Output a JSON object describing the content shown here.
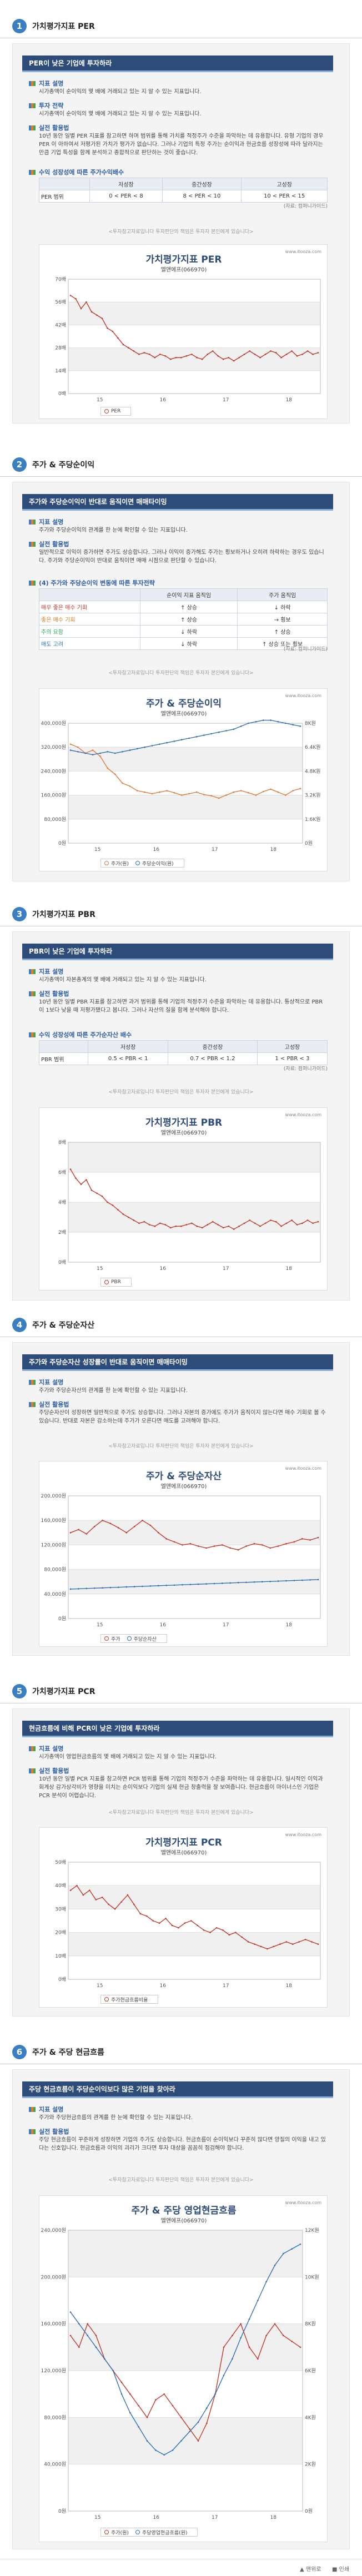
{
  "s1": {
    "num": "1",
    "title": "가치평가지표 PER",
    "banner": "PER이 낮은 기업에 투자하라",
    "h1": "지표 설명",
    "t1": "시가총액이 순이익의 몇 배에 거래되고 있는 지 알 수 있는 지표입니다.",
    "h2": "투자 전략",
    "t2": "시가총액이 순이익의 몇 배에 거래되고 있는 지 알 수 있는 지표입니다.",
    "h3": "실전 활용법",
    "t3": "10년 동안 일별 PER 지표를 참고하면 하며 범위를 통해 가치를 적정주가 수준을 파악하는 데 유용합니다. 유형 기업의 경우 PER 이 아하여서 저평가된 가치가 평가가 없습니다. 그러나 기업의 특정 주가는 순이익과 현금흐름 성장성에 따라 달라지는 만큼 기업 특성을 함께 분석하고 종합적으로 판단하는 것이 좋습니다.",
    "h4": "수익 성장성에 따른 주가수익배수",
    "th": [
      "",
      "저성장",
      "중간성장",
      "고성장"
    ],
    "row": [
      "PER 범위",
      "0 < PER < 8",
      "8 < PER < 10",
      "10 < PER < 15"
    ],
    "src": "(자료: 컴퍼니가이드)",
    "foot": "<투자참고자료입니다 투자판단의 책임은 투자자 본인에게 있습니다>"
  },
  "c1": {
    "title": "가치평가지표 PER",
    "sub": "엘앤에프(066970)",
    "url": "www.itooza.com",
    "legend": "PER"
  },
  "s2": {
    "num": "2",
    "title": "주가 & 주당순이익",
    "banner": "주가와 주당순이익이 반대로 움직이면 매매타이밍",
    "h1": "지표 설명",
    "t1": "주가와 주당순이익의 관계를 한 눈에 확인할 수 있는 지표입니다.",
    "h2": "실전 활용법",
    "t2": "일반적으로 이익이 증가하면 주가도 상승합니다. 그러나 이익이 증가해도 주가는 횡보하거나 오히려 하락하는 경우도 있습니다. 주가와 주당순이익이 반대로 움직이면 매매 시점으로 판단할 수 있습니다.",
    "h3": "(4) 주가와 주당순이익 변동에 따른 투자전략",
    "th": [
      "",
      "순이익 지표 움직임",
      "주가 움직임"
    ],
    "rows": [
      [
        "매우 좋은 매수 기회",
        "↑ 상승",
        "↓ 하락"
      ],
      [
        "좋은 매수 기회",
        "↑ 상승",
        "→ 횡보"
      ],
      [
        "주의 요함",
        "↓ 하락",
        "↑ 상승"
      ],
      [
        "매도 고려",
        "↓ 하락",
        "↑ 상승 또는 횡보"
      ]
    ],
    "row_colors": [
      "#c0392b",
      "#e67e22",
      "#27ae60",
      "#2e6fb5"
    ],
    "src": "(자료: 컴퍼니가이드)",
    "foot": "<투자참고자료입니다 투자판단의 책임은 투자자 본인에게 있습니다>"
  },
  "c2": {
    "title": "주가 & 주당순이익",
    "sub": "엘앤에프(066970)",
    "url": "www.itooza.com",
    "legend1": "주가(원)",
    "legend2": "주당순이익(원)"
  },
  "s3": {
    "num": "3",
    "title": "가치평가지표 PBR",
    "banner": "PBR이 낮은 기업에 투자하라",
    "h1": "지표 설명",
    "t1": "시가총액이 자본총계의 몇 배에 거래되고 있는 지 알 수 있는 지표입니다.",
    "h2": "실전 활용법",
    "t2": "10년 동안 일별 PBR 지표를 참고하면 과거 범위를 통해 기업의 적정주가 수준을 파악하는 데 유용합니다. 통상적으로 PBR이 1보다 낮을 때 저평가됐다고 봅니다. 그러나 자산의 질을 함께 분석해야 합니다.",
    "h3": "수익 성장성에 따른 주가순자산 배수",
    "th": [
      "",
      "저성장",
      "중간성장",
      "고성장"
    ],
    "row": [
      "PBR 범위",
      "0.5 < PBR < 1",
      "0.7 < PBR < 1.2",
      "1 < PBR < 3"
    ],
    "src": "(자료: 컴퍼니가이드)",
    "foot": "<투자참고자료입니다 투자판단의 책임은 투자자 본인에게 있습니다>"
  },
  "c3": {
    "title": "가치평가지표 PBR",
    "sub": "엘앤에프(066970)",
    "url": "www.itooza.com",
    "legend": "PBR"
  },
  "s4": {
    "num": "4",
    "title": "주가 & 주당순자산",
    "banner": "주가와 주당순자산 성장률이 반대로 움직이면 매매타이밍",
    "h1": "지표 설명",
    "t1": "주가와 주당순자산의 관계를 한 눈에 확인할 수 있는 지표입니다.",
    "h2": "실전 활용법",
    "t2": "주당순자산이 성장하면 일반적으로 주가도 상승합니다. 그러나 자본의 증가에도 주가가 움직이지 않는다면 매수 기회로 볼 수 있습니다. 반대로 자본은 감소하는데 주가가 오른다면 매도를 고려해야 합니다.",
    "foot": "<투자참고자료입니다 투자판단의 책임은 투자자 본인에게 있습니다>"
  },
  "c4": {
    "title": "주가 & 주당순자산",
    "sub": "엘앤에프(066970)",
    "url": "www.itooza.com",
    "legend1": "주가",
    "legend2": "주당순자산"
  },
  "s5": {
    "num": "5",
    "title": "가치평가지표 PCR",
    "banner": "현금흐름에 비해 PCR이 낮은 기업에 투자하라",
    "h1": "지표 설명",
    "t1": "시가총액이 영업현금흐름의 몇 배에 거래되고 있는 지 알 수 있는 지표입니다.",
    "h2": "실전 활용법",
    "t2": "10년 동안 일별 PCR 지표를 참고하면 PCR 범위를 통해 기업의 적정주가 수준을 파악하는 데 유용합니다. 일시적인 이익과 회계상 감가상각비가 영향을 미치는 순이익보다 기업의 실제 현금 창출력을 잘 보여줍니다. 현금흐름이 마이너스인 기업은 PCR 분석이 어렵습니다.",
    "foot": "<투자참고자료입니다 투자판단의 책임은 투자자 본인에게 있습니다>"
  },
  "c5": {
    "title": "가치평가지표 PCR",
    "sub": "엘앤에프(066970)",
    "url": "www.itooza.com",
    "legend": "주가현금흐름비율"
  },
  "s6": {
    "num": "6",
    "title": "주가 & 주당 현금흐름",
    "banner": "주당 현금흐름이 주당순이익보다 많은 기업을 찾아라",
    "h1": "지표 설명",
    "t1": "주가와 주당현금흐름의 관계를 한 눈에 확인할 수 있는 지표입니다.",
    "h2": "실전 활용법",
    "t2": "주당 현금흐름이 꾸준하게 성장하면 기업의 주가도 상승합니다. 현금흐름이 순이익보다 꾸준히 많다면 양질의 이익을 내고 있다는 신호입니다. 현금흐름과 이익의 괴리가 크다면 투자 대상을 꼼꼼히 점검해야 합니다.",
    "foot": "<투자참고자료입니다 투자판단의 책임은 투자자 본인에게 있습니다>"
  },
  "c6": {
    "title": "주가 & 주당 영업현금흐름",
    "sub": "엘앤에프(066970)",
    "url": "www.itooza.com",
    "legend1": "주가(원)",
    "legend2": "주당영업현금흐름(원)"
  },
  "bottom": {
    "left": "▲ 맨위로",
    "right": "■ 인쇄"
  },
  "chart_data": [
    {
      "type": "line",
      "title": "가치평가지표 PER",
      "subtitle": "엘앤에프(066970)",
      "x": [
        "15",
        "16",
        "17",
        "18"
      ],
      "yticks": [
        "0배",
        "14배",
        "28배",
        "42배",
        "56배",
        "70배"
      ],
      "ylim": [
        0,
        70
      ],
      "series": [
        {
          "name": "PER",
          "color": "#c0392b",
          "values": [
            60,
            58,
            52,
            56,
            50,
            48,
            46,
            40,
            38,
            34,
            30,
            28,
            26,
            24,
            25,
            24,
            22,
            24,
            23,
            21,
            22,
            22,
            23,
            24,
            22,
            21,
            24,
            26,
            23,
            21,
            22,
            20,
            22,
            24,
            26,
            24,
            22,
            24,
            26,
            25,
            22,
            24,
            26,
            23,
            24,
            26,
            24,
            25
          ]
        }
      ]
    },
    {
      "type": "line",
      "title": "주가 & 주당순이익",
      "subtitle": "엘앤에프(066970)",
      "x": [
        "15",
        "16",
        "17",
        "18"
      ],
      "yticks": [
        "0원",
        "80,000원",
        "160,000원",
        "240,000원",
        "320,000원",
        "400,000원"
      ],
      "ylim": [
        0,
        400000
      ],
      "y2ticks": [
        "0원",
        "1.6K원",
        "3.2K원",
        "4.8K원",
        "6.4K원",
        "8K원"
      ],
      "y2lim": [
        0,
        8000
      ],
      "series": [
        {
          "name": "주가(원)",
          "color": "#e07b39",
          "values": [
            330000,
            320000,
            300000,
            310000,
            290000,
            250000,
            230000,
            200000,
            190000,
            175000,
            170000,
            165000,
            170000,
            175000,
            168000,
            160000,
            165000,
            170000,
            162000,
            158000,
            150000,
            160000,
            170000,
            175000,
            168000,
            160000,
            172000,
            180000,
            170000,
            160000,
            175000,
            182000
          ]
        },
        {
          "name": "주당순이익(원)",
          "color": "#2e6fb5",
          "values": [
            6200,
            6100,
            6000,
            5900,
            6000,
            6100,
            6000,
            6100,
            6200,
            6300,
            6400,
            6500,
            6600,
            6700,
            6800,
            6900,
            7000,
            7100,
            7200,
            7300,
            7400,
            7500,
            7600,
            7800,
            8000,
            8100,
            8200,
            8200,
            8100,
            8000,
            7900,
            7800
          ]
        }
      ]
    },
    {
      "type": "line",
      "title": "가치평가지표 PBR",
      "subtitle": "엘앤에프(066970)",
      "x": [
        "15",
        "16",
        "17",
        "18"
      ],
      "yticks": [
        "0배",
        "2배",
        "4배",
        "6배",
        "8배"
      ],
      "ylim": [
        0,
        8
      ],
      "series": [
        {
          "name": "PBR",
          "color": "#c0392b",
          "values": [
            6.2,
            5.6,
            5.2,
            5.5,
            4.8,
            4.6,
            4.4,
            4.0,
            3.8,
            3.5,
            3.2,
            3.0,
            2.8,
            2.6,
            2.7,
            2.5,
            2.4,
            2.6,
            2.5,
            2.3,
            2.4,
            2.4,
            2.5,
            2.6,
            2.4,
            2.3,
            2.5,
            2.7,
            2.5,
            2.3,
            2.4,
            2.2,
            2.4,
            2.6,
            2.8,
            2.6,
            2.4,
            2.6,
            2.8,
            2.7,
            2.4,
            2.6,
            2.8,
            2.5,
            2.6,
            2.8,
            2.6,
            2.7
          ]
        }
      ]
    },
    {
      "type": "line",
      "title": "주가 & 주당순자산",
      "subtitle": "엘앤에프(066970)",
      "x": [
        "15",
        "16",
        "17",
        "18"
      ],
      "yticks": [
        "0원",
        "40,000원",
        "80,000원",
        "120,000원",
        "160,000원",
        "200,000원"
      ],
      "ylim": [
        0,
        200000
      ],
      "series": [
        {
          "name": "주가",
          "color": "#c0392b",
          "values": [
            140000,
            145000,
            138000,
            150000,
            160000,
            155000,
            148000,
            140000,
            150000,
            160000,
            152000,
            140000,
            130000,
            125000,
            120000,
            122000,
            118000,
            115000,
            118000,
            120000,
            115000,
            112000,
            118000,
            122000,
            120000,
            115000,
            118000,
            122000,
            125000,
            130000,
            128000,
            132000
          ]
        },
        {
          "name": "주당순자산",
          "color": "#2e6fb5",
          "values": [
            48000,
            48500,
            49000,
            49500,
            50000,
            50500,
            51000,
            51500,
            52000,
            52500,
            53000,
            53500,
            54000,
            54500,
            55000,
            55500,
            56000,
            56500,
            57000,
            57500,
            58000,
            58500,
            59000,
            59500,
            60000,
            60500,
            61000,
            61500,
            62000,
            62500,
            63000,
            63500
          ]
        }
      ]
    },
    {
      "type": "line",
      "title": "가치평가지표 PCR",
      "subtitle": "엘앤에프(066970)",
      "x": [
        "15",
        "16",
        "17",
        "18"
      ],
      "yticks": [
        "0배",
        "10배",
        "20배",
        "30배",
        "40배",
        "50배"
      ],
      "ylim": [
        0,
        50
      ],
      "series": [
        {
          "name": "주가현금흐름비율",
          "color": "#c0392b",
          "values": [
            38,
            40,
            36,
            38,
            34,
            35,
            32,
            30,
            33,
            36,
            32,
            28,
            27,
            25,
            24,
            26,
            23,
            22,
            24,
            25,
            23,
            21,
            20,
            22,
            21,
            19,
            20,
            18,
            16,
            15,
            14,
            13,
            14,
            15,
            16,
            15,
            16,
            17,
            16,
            15
          ]
        }
      ]
    },
    {
      "type": "line",
      "title": "주가 & 주당 영업현금흐름",
      "subtitle": "엘앤에프(066970)",
      "x": [
        "15",
        "16",
        "17",
        "18"
      ],
      "yticks": [
        "0원",
        "40,000원",
        "80,000원",
        "120,000원",
        "160,000원",
        "200,000원",
        "240,000원"
      ],
      "ylim": [
        0,
        240000
      ],
      "y2ticks": [
        "0원",
        "2K원",
        "4K원",
        "6K원",
        "8K원",
        "10K원",
        "12K원"
      ],
      "y2lim": [
        0,
        12000
      ],
      "series": [
        {
          "name": "주가(원)",
          "color": "#c0392b",
          "values": [
            150000,
            140000,
            160000,
            150000,
            130000,
            120000,
            110000,
            100000,
            90000,
            80000,
            95000,
            100000,
            90000,
            80000,
            70000,
            60000,
            75000,
            100000,
            140000,
            150000,
            160000,
            140000,
            130000,
            150000,
            160000,
            150000,
            145000,
            140000
          ]
        },
        {
          "name": "주당영업현금흐름(원)",
          "color": "#2e6fb5",
          "values": [
            8500,
            8000,
            7500,
            7000,
            6500,
            6000,
            5000,
            4200,
            3600,
            3000,
            2600,
            2400,
            2600,
            3000,
            3400,
            3800,
            4400,
            5000,
            5800,
            6500,
            7400,
            8200,
            9000,
            9800,
            10500,
            11000,
            11200,
            11400
          ]
        }
      ]
    }
  ]
}
